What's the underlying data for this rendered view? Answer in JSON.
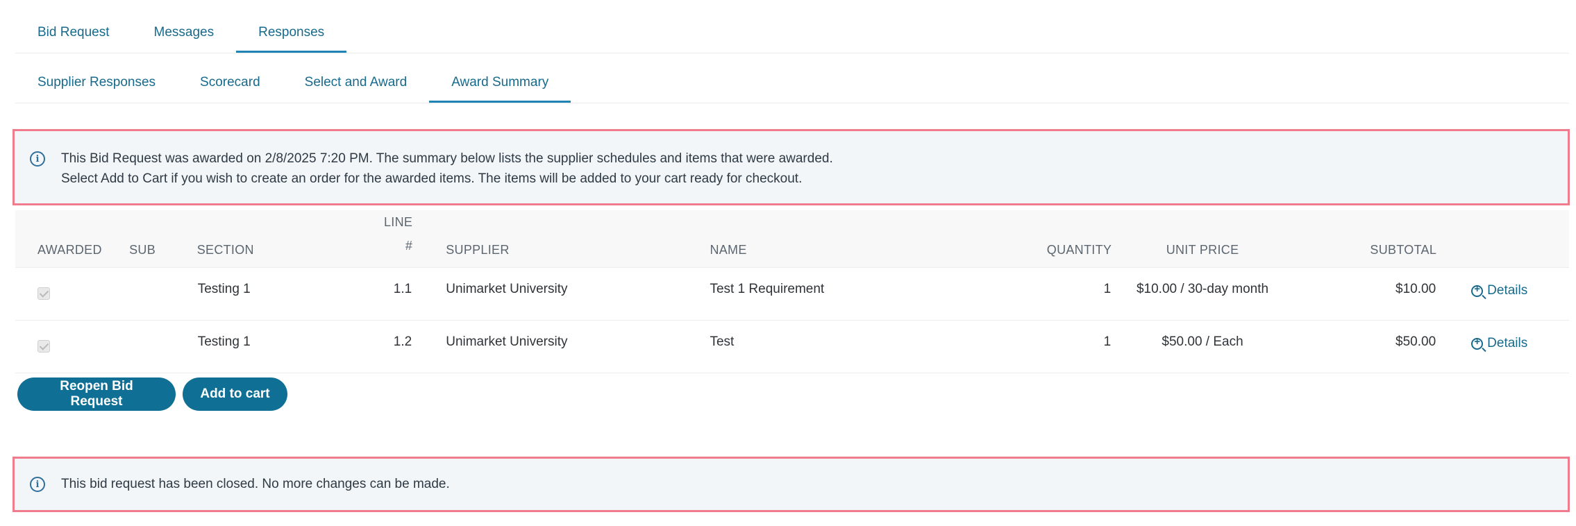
{
  "tabs_main": [
    {
      "label": "Bid Request",
      "active": false
    },
    {
      "label": "Messages",
      "active": false
    },
    {
      "label": "Responses",
      "active": true
    }
  ],
  "tabs_sub": [
    {
      "label": "Supplier Responses",
      "active": false
    },
    {
      "label": "Scorecard",
      "active": false
    },
    {
      "label": "Select and Award",
      "active": false
    },
    {
      "label": "Award Summary",
      "active": true
    }
  ],
  "award_alert": {
    "line1": "This Bid Request was awarded on 2/8/2025 7:20 PM. The summary below lists the supplier schedules and items that were awarded.",
    "line2": "Select Add to Cart if you wish to create an order for the awarded items. The items will be added to your cart ready for checkout."
  },
  "table": {
    "headers": {
      "awarded": "AWARDED",
      "sub": "SUB",
      "section": "SECTION",
      "line_top": "LINE",
      "line_bottom": "#",
      "supplier": "SUPPLIER",
      "name": "NAME",
      "quantity": "QUANTITY",
      "unit_price": "UNIT PRICE",
      "subtotal": "SUBTOTAL"
    },
    "rows": [
      {
        "awarded": true,
        "sub": "",
        "section": "Testing 1",
        "line": "1.1",
        "supplier": "Unimarket University",
        "name": "Test 1 Requirement",
        "quantity": "1",
        "unit_price": "$10.00 / 30-day month",
        "subtotal": "$10.00",
        "details_label": "Details"
      },
      {
        "awarded": true,
        "sub": "",
        "section": "Testing 1",
        "line": "1.2",
        "supplier": "Unimarket University",
        "name": "Test",
        "quantity": "1",
        "unit_price": "$50.00 / Each",
        "subtotal": "$50.00",
        "details_label": "Details"
      }
    ]
  },
  "buttons": {
    "reopen": "Reopen Bid Request",
    "add_to_cart": "Add to cart"
  },
  "closed_alert": {
    "text": "This bid request has been closed. No more changes can be made."
  },
  "colors": {
    "link": "#176a8c",
    "primary_button": "#0f6f94",
    "highlight_border": "#ef7b8c",
    "alert_bg": "#f2f6f9"
  },
  "icons": {
    "info": "info-circle-icon",
    "details": "zoom-in-icon"
  }
}
